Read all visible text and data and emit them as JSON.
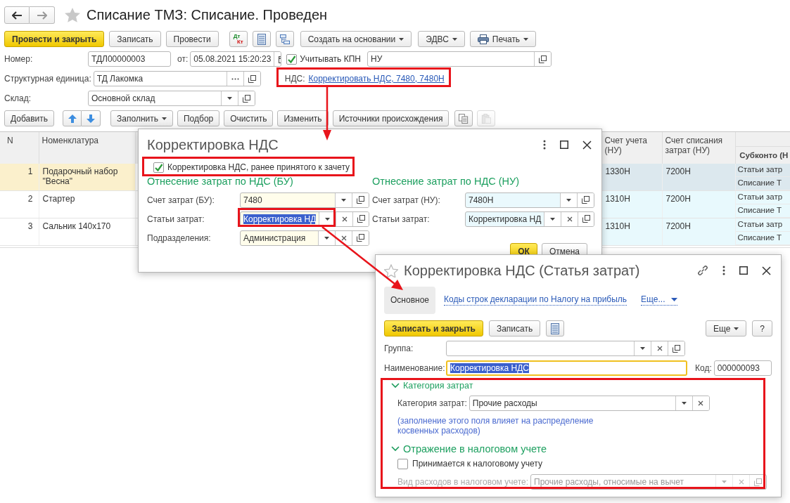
{
  "window": {
    "title": "Списание ТМЗ: Списание. Проведен"
  },
  "toolbar": [
    {
      "kind": "primary",
      "label": "Провести и закрыть"
    },
    {
      "kind": "button",
      "label": "Записать"
    },
    {
      "kind": "button",
      "label": "Провести"
    },
    {
      "kind": "dtkt",
      "label": "Дт",
      "sublabel": "Кт"
    },
    {
      "kind": "list"
    },
    {
      "kind": "structure"
    },
    {
      "kind": "menu",
      "label": "Создать на основании"
    },
    {
      "kind": "menu",
      "label": "ЭДВС"
    },
    {
      "kind": "print",
      "label": "Печать"
    }
  ],
  "header": {
    "number": {
      "label": "Номер:",
      "value": "ТДЛ00000003"
    },
    "date": {
      "label": "от:",
      "value": "05.08.2021 15:20:23"
    },
    "kpn": {
      "label": "Учитывать КПН",
      "checked": true,
      "value": "НУ"
    },
    "unit": {
      "label": "Структурная единица:",
      "value": "ТД Лакомка"
    },
    "vat": {
      "label": "НДС:",
      "link": "Корректировать НДС, 7480, 7480Н"
    },
    "warehouse": {
      "label": "Склад:",
      "value": "Основной склад"
    }
  },
  "table_toolbar": [
    {
      "kind": "button",
      "label": "Добавить"
    },
    {
      "kind": "up"
    },
    {
      "kind": "down"
    },
    {
      "kind": "menu",
      "label": "Заполнить"
    },
    {
      "kind": "button",
      "label": "Подбор"
    },
    {
      "kind": "button",
      "label": "Очистить"
    },
    {
      "kind": "button",
      "label": "Изменить"
    },
    {
      "kind": "button",
      "label": "Источники происхождения"
    },
    {
      "kind": "copy",
      "disabled": false
    },
    {
      "kind": "paste",
      "disabled": true
    }
  ],
  "table": {
    "columns": [
      {
        "label": "N"
      },
      {
        "label": "Номенклатура"
      },
      {
        "label": "Счет учета (НУ)"
      },
      {
        "label": "Счет списания затрат (НУ)"
      },
      {
        "label": "Субконто (Н"
      }
    ],
    "rows": [
      {
        "n": "1",
        "item": "Подарочный набор \"Весна\"",
        "account": "1330Н",
        "writeoff": "7200Н",
        "subconto": [
          "Статьи затр",
          "Списание Т"
        ],
        "selected": true
      },
      {
        "n": "2",
        "item": "Стартер",
        "account": "1310Н",
        "writeoff": "7200Н",
        "subconto": [
          "Статьи затр",
          "Списание Т"
        ],
        "selected": false
      },
      {
        "n": "3",
        "item": "Сальник 140х170",
        "account": "1310Н",
        "writeoff": "7200Н",
        "subconto": [
          "Статьи затр",
          "Списание Т"
        ],
        "selected": false
      }
    ]
  },
  "vat_dialog": {
    "title": "Корректировка НДС",
    "checkbox": {
      "label": "Корректировка НДС, ранее принятого к зачету",
      "checked": true
    },
    "sections": [
      {
        "heading": "Отнесение затрат по НДС (БУ)",
        "fields": [
          {
            "label": "Счет затрат (БУ):",
            "value": "7480",
            "dropdown": true,
            "clear": false,
            "open": true,
            "highlighted": false
          },
          {
            "label": "Статьи затрат:",
            "value": "Корректировка НД",
            "dropdown": true,
            "clear": true,
            "open": true,
            "highlighted": true
          },
          {
            "label": "Подразделения:",
            "value": "Администрация",
            "dropdown": true,
            "clear": true,
            "open": true,
            "highlighted": false
          }
        ]
      },
      {
        "heading": "Отнесение затрат по НДС (НУ)",
        "fields": [
          {
            "label": "Счет затрат (НУ):",
            "value": "7480Н",
            "dropdown": true,
            "clear": false,
            "open": true,
            "highlighted": false
          },
          {
            "label": "Статьи затрат:",
            "value": "Корректировка НД",
            "dropdown": true,
            "clear": true,
            "open": true,
            "highlighted": false
          }
        ]
      }
    ],
    "buttons": [
      {
        "kind": "primary",
        "label": "ОК"
      },
      {
        "kind": "button",
        "label": "Отмена"
      }
    ]
  },
  "item_dialog": {
    "title": "Корректировка НДС (Статья затрат)",
    "tabs": [
      {
        "label": "Основное",
        "selected": true
      },
      {
        "label": "Коды строк декларации по Налогу на прибыль",
        "selected": false
      }
    ],
    "more": "Еще...",
    "toolbar": [
      {
        "kind": "primary",
        "label": "Записать и закрыть"
      },
      {
        "kind": "button",
        "label": "Записать"
      },
      {
        "kind": "list"
      }
    ],
    "toolbar_right": [
      {
        "kind": "menu",
        "label": "Еще"
      },
      {
        "kind": "button",
        "label": "?"
      }
    ],
    "group": {
      "label": "Группа:",
      "dropdown": true,
      "clear": true,
      "open": true
    },
    "name": {
      "label": "Наименование:",
      "value": "Корректировка НДС",
      "highlighted": true
    },
    "code": {
      "label": "Код:",
      "value": "000000093"
    },
    "sections": [
      {
        "kind": "category",
        "heading": "Категория затрат",
        "expanded": true,
        "field": {
          "label": "Категория затрат:",
          "value": "Прочие расходы",
          "dropdown": true,
          "clear": true,
          "open": false,
          "disabled": false
        },
        "note": "(заполнение этого поля влияет на распределение косвенных расходов)"
      },
      {
        "kind": "tax",
        "heading": "Отражение в налоговом учете",
        "expanded": true,
        "checkbox": {
          "label": "Принимается к налоговому учету",
          "checked": false
        },
        "field": {
          "label": "Вид расходов в налоговом учете:",
          "value": "Прочие расходы, относимые на вычет",
          "dropdown": true,
          "clear": true,
          "open": true,
          "disabled": true
        }
      }
    ]
  }
}
